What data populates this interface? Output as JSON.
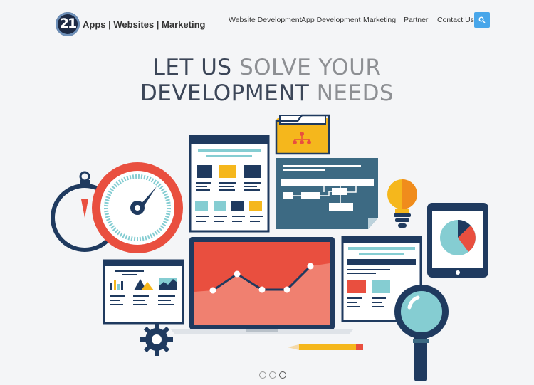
{
  "header": {
    "logo_badge": "21",
    "logo_text": "Apps | Websites | Marketing",
    "nav": [
      "Website Development",
      "App Development",
      "Marketing",
      "Partner",
      "Contact Us"
    ],
    "search_icon": "search-icon"
  },
  "hero": {
    "line1_dark": "LET US",
    "line1_light": "SOLVE YOUR",
    "line2_dark": "DEVELOPMENT",
    "line2_light": "NEEDS"
  },
  "carousel": {
    "slides": 3,
    "active": 3
  },
  "colors": {
    "accent": "#48a6ea",
    "navy": "#1f3a5f",
    "red": "#e94f3f",
    "yellow": "#f5b71c",
    "teal": "#85cdd2"
  }
}
